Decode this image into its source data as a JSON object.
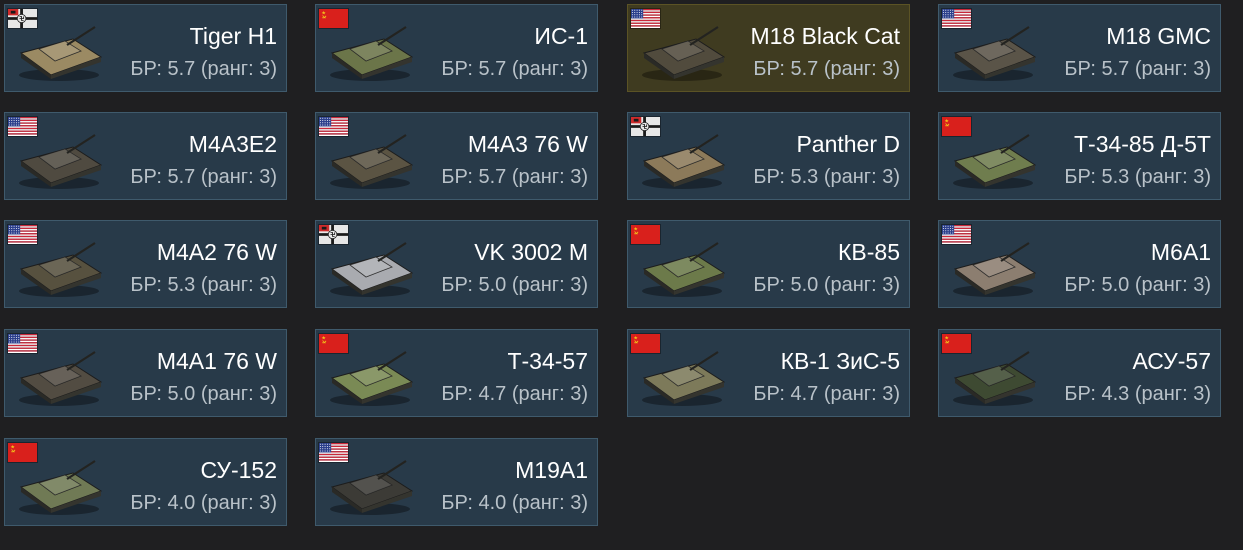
{
  "vehicles": [
    {
      "name": "Tiger H1",
      "br": "БР: 5.7 (ранг: 3)",
      "nation": "germany",
      "selected": false,
      "tank_color": "#9b8a63"
    },
    {
      "name": "ИС-1",
      "br": "БР: 5.7 (ранг: 3)",
      "nation": "ussr",
      "selected": false,
      "tank_color": "#6b7549"
    },
    {
      "name": "M18 Black Cat",
      "br": "БР: 5.7 (ранг: 3)",
      "nation": "usa",
      "selected": true,
      "tank_color": "#514b3d"
    },
    {
      "name": "M18 GMC",
      "br": "БР: 5.7 (ранг: 3)",
      "nation": "usa",
      "selected": false,
      "tank_color": "#5a5448"
    },
    {
      "name": "M4A3E2",
      "br": "БР: 5.7 (ранг: 3)",
      "nation": "usa",
      "selected": false,
      "tank_color": "#4f4a40"
    },
    {
      "name": "M4A3 76 W",
      "br": "БР: 5.7 (ранг: 3)",
      "nation": "usa",
      "selected": false,
      "tank_color": "#5b5443"
    },
    {
      "name": "Panther D",
      "br": "БР: 5.3 (ранг: 3)",
      "nation": "germany",
      "selected": false,
      "tank_color": "#8c7a5a"
    },
    {
      "name": "Т-34-85 Д-5Т",
      "br": "БР: 5.3 (ранг: 3)",
      "nation": "ussr",
      "selected": false,
      "tank_color": "#6f7d4e"
    },
    {
      "name": "M4A2 76 W",
      "br": "БР: 5.3 (ранг: 3)",
      "nation": "usa",
      "selected": false,
      "tank_color": "#57513f"
    },
    {
      "name": "VK 3002 M",
      "br": "БР: 5.0 (ранг: 3)",
      "nation": "germany",
      "selected": false,
      "tank_color": "#a9abb0"
    },
    {
      "name": "КВ-85",
      "br": "БР: 5.0 (ранг: 3)",
      "nation": "ussr",
      "selected": false,
      "tank_color": "#6c7a4a"
    },
    {
      "name": "M6A1",
      "br": "БР: 5.0 (ранг: 3)",
      "nation": "usa",
      "selected": false,
      "tank_color": "#8c7e70"
    },
    {
      "name": "M4A1 76 W",
      "br": "БР: 5.0 (ранг: 3)",
      "nation": "usa",
      "selected": false,
      "tank_color": "#524c42"
    },
    {
      "name": "Т-34-57",
      "br": "БР: 4.7 (ранг: 3)",
      "nation": "ussr",
      "selected": false,
      "tank_color": "#7a8a55"
    },
    {
      "name": "КВ-1 ЗиС-5",
      "br": "БР: 4.7 (ранг: 3)",
      "nation": "ussr",
      "selected": false,
      "tank_color": "#7d7a5a"
    },
    {
      "name": "АСУ-57",
      "br": "БР: 4.3 (ранг: 3)",
      "nation": "ussr",
      "selected": false,
      "tank_color": "#3e4a32"
    },
    {
      "name": "СУ-152",
      "br": "БР: 4.0 (ранг: 3)",
      "nation": "ussr",
      "selected": false,
      "tank_color": "#707a55"
    },
    {
      "name": "M19A1",
      "br": "БР: 4.0 (ранг: 3)",
      "nation": "usa",
      "selected": false,
      "tank_color": "#3c3b36"
    }
  ]
}
